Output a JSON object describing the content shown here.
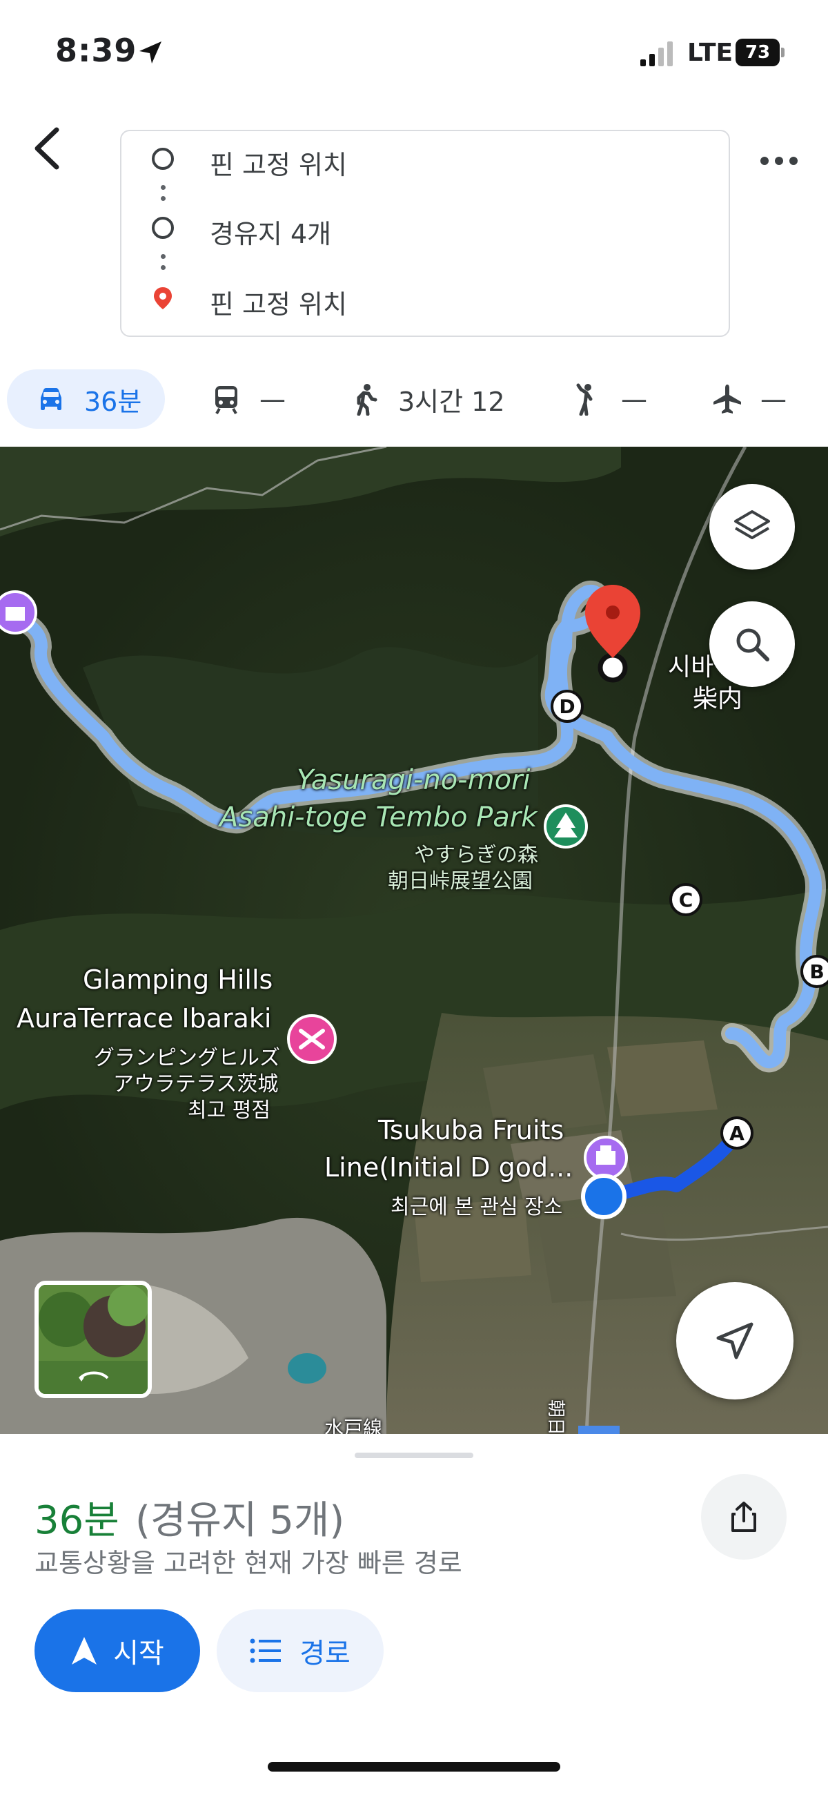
{
  "status_bar": {
    "time": "8:39",
    "network": "LTE",
    "battery": "73"
  },
  "route": {
    "origin": "핀 고정 위치",
    "waypoints": "경유지 4개",
    "destination": "핀 고정 위치"
  },
  "modes": [
    {
      "icon": "car-icon",
      "label": "36분",
      "active": true
    },
    {
      "icon": "train-icon",
      "label": "—"
    },
    {
      "icon": "walk-icon",
      "label": "3시간 12"
    },
    {
      "icon": "rideshare-icon",
      "label": "—"
    },
    {
      "icon": "plane-icon",
      "label": "—"
    }
  ],
  "map": {
    "poi_park_en_1": "Yasuragi-no-mori",
    "poi_park_en_2": "Asahi-toge Tembo Park",
    "poi_park_ja_1": "やすらぎの森",
    "poi_park_ja_2": "朝日峠展望公園",
    "poi_glamp_en_1": "Glamping Hills",
    "poi_glamp_en_2": "AuraTerrace Ibaraki",
    "poi_glamp_ja_1": "グランピングヒルズ",
    "poi_glamp_ja_2": "アウラテラス茨城",
    "poi_glamp_rating": "최고 평점",
    "poi_fruits_1": "Tsukuba Fruits",
    "poi_fruits_2": "Line(Initial D god...",
    "poi_fruits_sub": "최근에 본 관심 장소",
    "place_shibauchi_1": "시바",
    "place_shibauchi_2": "柴内",
    "tunnel": "朝日トンネル",
    "rail": "水戸線",
    "waypoint_labels": [
      "A",
      "B",
      "C",
      "D"
    ],
    "colors": {
      "route": "#7fb2f5",
      "route_active": "#1a57e6",
      "pin": "#ea4335",
      "location": "#1a73e8"
    }
  },
  "summary": {
    "duration": "36분",
    "stops": "(경유지 5개)",
    "description": "교통상황을 고려한 현재 가장 빠른 경로",
    "start_label": "시작",
    "steps_label": "경로"
  }
}
